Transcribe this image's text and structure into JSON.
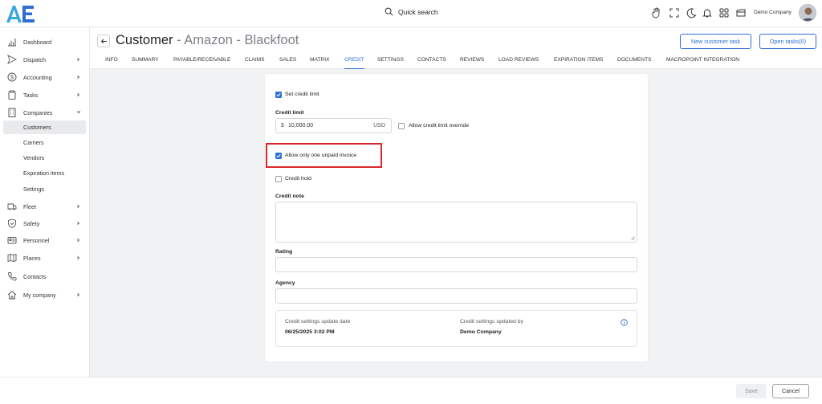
{
  "app": {
    "brand_color": "#2f6fd1",
    "logo_letters": "AE"
  },
  "topbar": {
    "search_label": "Quick search",
    "company_name": "Demo Company",
    "icons": [
      "hand-icon",
      "expand-icon",
      "moon-icon",
      "bell-icon",
      "apps-grid-icon",
      "folder-icon"
    ]
  },
  "sidebar": {
    "items": [
      {
        "label": "Dashboard",
        "icon": "chart-icon"
      },
      {
        "label": "Dispatch",
        "icon": "send-icon"
      },
      {
        "label": "Accounting",
        "icon": "dollar-icon"
      },
      {
        "label": "Tasks",
        "icon": "clipboard-icon"
      },
      {
        "label": "Companies",
        "icon": "building-icon"
      },
      {
        "label": "Fleet",
        "icon": "truck-icon"
      },
      {
        "label": "Safety",
        "icon": "shield-icon"
      },
      {
        "label": "Personnel",
        "icon": "id-card-icon"
      },
      {
        "label": "Places",
        "icon": "map-icon"
      },
      {
        "label": "Contacts",
        "icon": "phone-icon"
      },
      {
        "label": "My company",
        "icon": "home-icon"
      }
    ],
    "companies_sub": [
      "Customers",
      "Carriers",
      "Vendors",
      "Expiration items",
      "Settings"
    ]
  },
  "header": {
    "title_main": "Customer",
    "title_rest": " - Amazon - Blackfoot",
    "new_task_label": "New customer task",
    "open_tasks_label": "Open tasks(0)"
  },
  "tabs": [
    "INFO",
    "SUMMARY",
    "PAYABLE/RECEIVABLE",
    "CLAIMS",
    "SALES",
    "MATRIX",
    "CREDIT",
    "SETTINGS",
    "CONTACTS",
    "REVIEWS",
    "LOAD REVIEWS",
    "EXPIRATION ITEMS",
    "DOCUMENTS",
    "MACROPOINT INTEGRATION"
  ],
  "active_tab": "CREDIT",
  "credit": {
    "set_credit_limit": {
      "label": "Set credit limit",
      "checked": true
    },
    "credit_limit_label": "Credit limit",
    "currency_symbol": "$",
    "credit_limit_value": "10,000.00",
    "currency": "USD",
    "allow_override": {
      "label": "Allow credit limit override",
      "checked": false
    },
    "one_unpaid": {
      "label": "Allow only one unpaid invoice",
      "checked": true
    },
    "credit_hold": {
      "label": "Credit hold",
      "checked": false
    },
    "credit_note_label": "Credit note",
    "credit_note_value": "",
    "rating_label": "Rating",
    "rating_value": "",
    "agency_label": "Agency",
    "agency_value": "",
    "update_date_label": "Credit settings update date",
    "update_date_value": "06/25/2025 3:02 PM",
    "updated_by_label": "Credit settings updated by",
    "updated_by_value": "Demo Company",
    "highlight_color": "#d9262c"
  },
  "footer": {
    "save_label": "Save",
    "cancel_label": "Cancel"
  }
}
